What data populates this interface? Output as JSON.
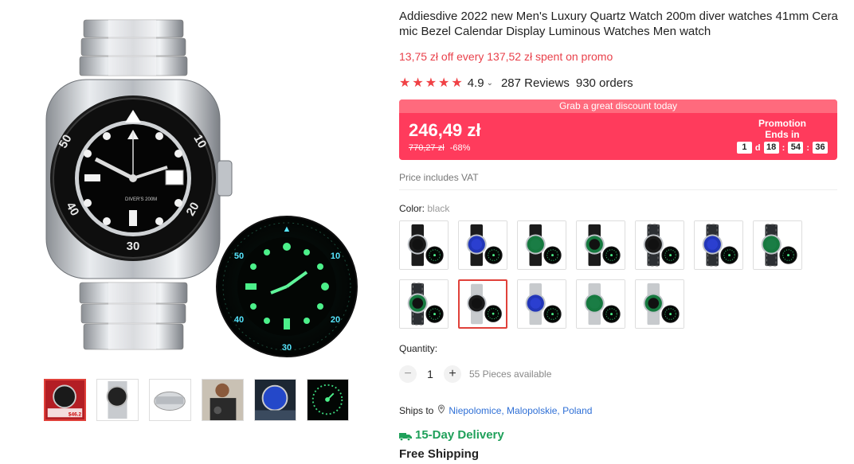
{
  "product": {
    "title": "Addiesdive 2022 new Men's Luxury Quartz Watch 200m diver watches 41mm Ceramic Bezel Calendar Display Luminous Watches Men watch",
    "promo_line": "13,75 zł off every 137,52 zł spent on promo",
    "rating": "4.9",
    "reviews": "287 Reviews",
    "orders": "930 orders",
    "stars": 5
  },
  "price": {
    "banner": "Grab a great discount today",
    "current": "246,49 zł",
    "original": "770,27 zł",
    "discount": "-68%",
    "promotion_label": "Promotion",
    "ends_in_label": "Ends in",
    "countdown": {
      "days": "1",
      "d": "d",
      "hours": "18",
      "minutes": "54",
      "seconds": "36",
      "sep": ":"
    }
  },
  "vat": "Price includes VAT",
  "color": {
    "label": "Color:",
    "value": "black"
  },
  "swatches": [
    {
      "strap": "black",
      "dial": "black",
      "bezel": "black"
    },
    {
      "strap": "black",
      "dial": "blue",
      "bezel": "blue"
    },
    {
      "strap": "black",
      "dial": "green",
      "bezel": "green"
    },
    {
      "strap": "black",
      "dial": "black",
      "bezel": "green"
    },
    {
      "strap": "nato",
      "dial": "black",
      "bezel": "black"
    },
    {
      "strap": "nato",
      "dial": "blue",
      "bezel": "blue"
    },
    {
      "strap": "nato",
      "dial": "green",
      "bezel": "green"
    },
    {
      "strap": "nato",
      "dial": "black",
      "bezel": "green"
    },
    {
      "strap": "steel",
      "dial": "black",
      "bezel": "black",
      "selected": true
    },
    {
      "strap": "steel",
      "dial": "blue",
      "bezel": "blue"
    },
    {
      "strap": "steel",
      "dial": "green",
      "bezel": "green"
    },
    {
      "strap": "steel",
      "dial": "black",
      "bezel": "green"
    }
  ],
  "quantity": {
    "label": "Quantity:",
    "minus": "−",
    "value": "1",
    "plus": "+",
    "available": "55 Pieces available"
  },
  "shipping": {
    "ships_to_label": "Ships to",
    "location": "Niepolomice, Malopolskie, Poland",
    "delivery": "15-Day Delivery",
    "free_shipping": "Free Shipping"
  },
  "image_badges": {
    "badge_a": "$46.2"
  },
  "colors": {
    "accent": "#ff3b5c",
    "accent_light": "#ff6a7d",
    "promo_text": "#e9414b",
    "delivery": "#1fa05a",
    "link": "#2e6fd6"
  }
}
